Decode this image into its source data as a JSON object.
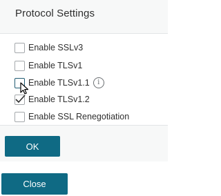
{
  "panel": {
    "title": "Protocol Settings"
  },
  "options": [
    {
      "label": "Enable SSLv3",
      "checked": false
    },
    {
      "label": "Enable TLSv1",
      "checked": false
    },
    {
      "label": "Enable TLSv1.1",
      "checked": false,
      "hovered": true
    },
    {
      "label": "Enable TLSv1.2",
      "checked": true
    },
    {
      "label": "Enable SSL Renegotiation",
      "checked": false
    }
  ],
  "info_icon": {
    "glyph": "i",
    "name": "info-icon"
  },
  "buttons": {
    "ok_label": "OK",
    "close_label": "Close"
  },
  "colors": {
    "button_bg": "#0f6a84",
    "panel_bg": "#f7f8f8",
    "text": "#2e2e2e"
  }
}
